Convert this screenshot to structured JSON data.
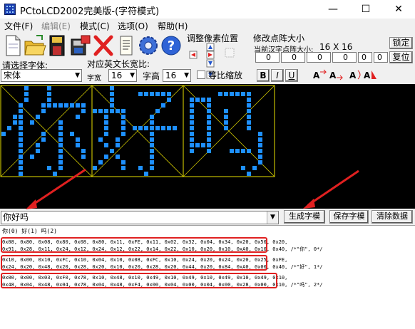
{
  "window": {
    "title": "PCtoLCD2002完美版-(字符模式)",
    "minimize_glyph": "—",
    "maximize_glyph": "☐",
    "close_glyph": "✕"
  },
  "menu": [
    "文件(F)",
    "编辑(E)",
    "模式(C)",
    "选项(O)",
    "帮助(H)"
  ],
  "toolbar": {
    "icons": [
      "new-file-icon",
      "open-folder-icon",
      "save-disk-icon",
      "save-as-icon",
      "delete-x-icon",
      "document-icon",
      "settings-gear-icon",
      "help-icon"
    ]
  },
  "shift_group": {
    "label": "调整像素位置"
  },
  "resize_group": {
    "label": "修改点阵大小",
    "current_label": "当前汉字点阵大小:",
    "size_display": "16  X  16",
    "lock_label": "锁定",
    "restore_label": "复位",
    "spinners": [
      "0",
      "0",
      "0",
      "0",
      "0",
      "0"
    ]
  },
  "font_select": {
    "label": "请选择字体:",
    "value": "宋体"
  },
  "english_ratio": {
    "label": "对应英文长宽比:",
    "width_label": "字宽",
    "width_value": "16",
    "height_label": "字高",
    "height_value": "16",
    "scale_label": "等比缩放"
  },
  "style_buttons": [
    "B",
    "I",
    "U"
  ],
  "matrix_chars": [
    "你",
    "好",
    "吗"
  ],
  "input": {
    "value": "你好吗"
  },
  "actions": {
    "generate": "生成字模",
    "save": "保存字模",
    "clear": "清除数据"
  },
  "output": {
    "header": "你(0) 好(1) 吗(2)",
    "lines": [
      "0x08, 0x80, 0x08, 0x80, 0x08, 0x80, 0x11, 0xFE, 0x11, 0x02, 0x32, 0x04, 0x34, 0x20, 0x50, 0x20,",
      "0x91, 0x28, 0x11, 0x24, 0x12, 0x24, 0x12, 0x22, 0x14, 0x22, 0x10, 0x20, 0x10, 0xA0, 0x10, 0x40, /*\"你\", 0*/",
      "0x10, 0x00, 0x10, 0xFC, 0x10, 0x04, 0x10, 0x08, 0xFC, 0x10, 0x24, 0x20, 0x24, 0x20, 0x25, 0xFE,",
      "0x24, 0x20, 0x48, 0x20, 0x28, 0x20, 0x10, 0x20, 0x28, 0x20, 0x44, 0x20, 0x84, 0xA0, 0x00, 0x40, /*\"好\", 1*/",
      "0x00, 0x00, 0x03, 0xF0, 0x78, 0x10, 0x48, 0x10, 0x49, 0x10, 0x49, 0x10, 0x49, 0x10, 0x49, 0x10,",
      "0x48, 0x04, 0x48, 0x04, 0x78, 0x04, 0x48, 0xF4, 0x00, 0x04, 0x00, 0x04, 0x00, 0x28, 0x00, 0x10, /*\"吗\", 2*/"
    ]
  }
}
